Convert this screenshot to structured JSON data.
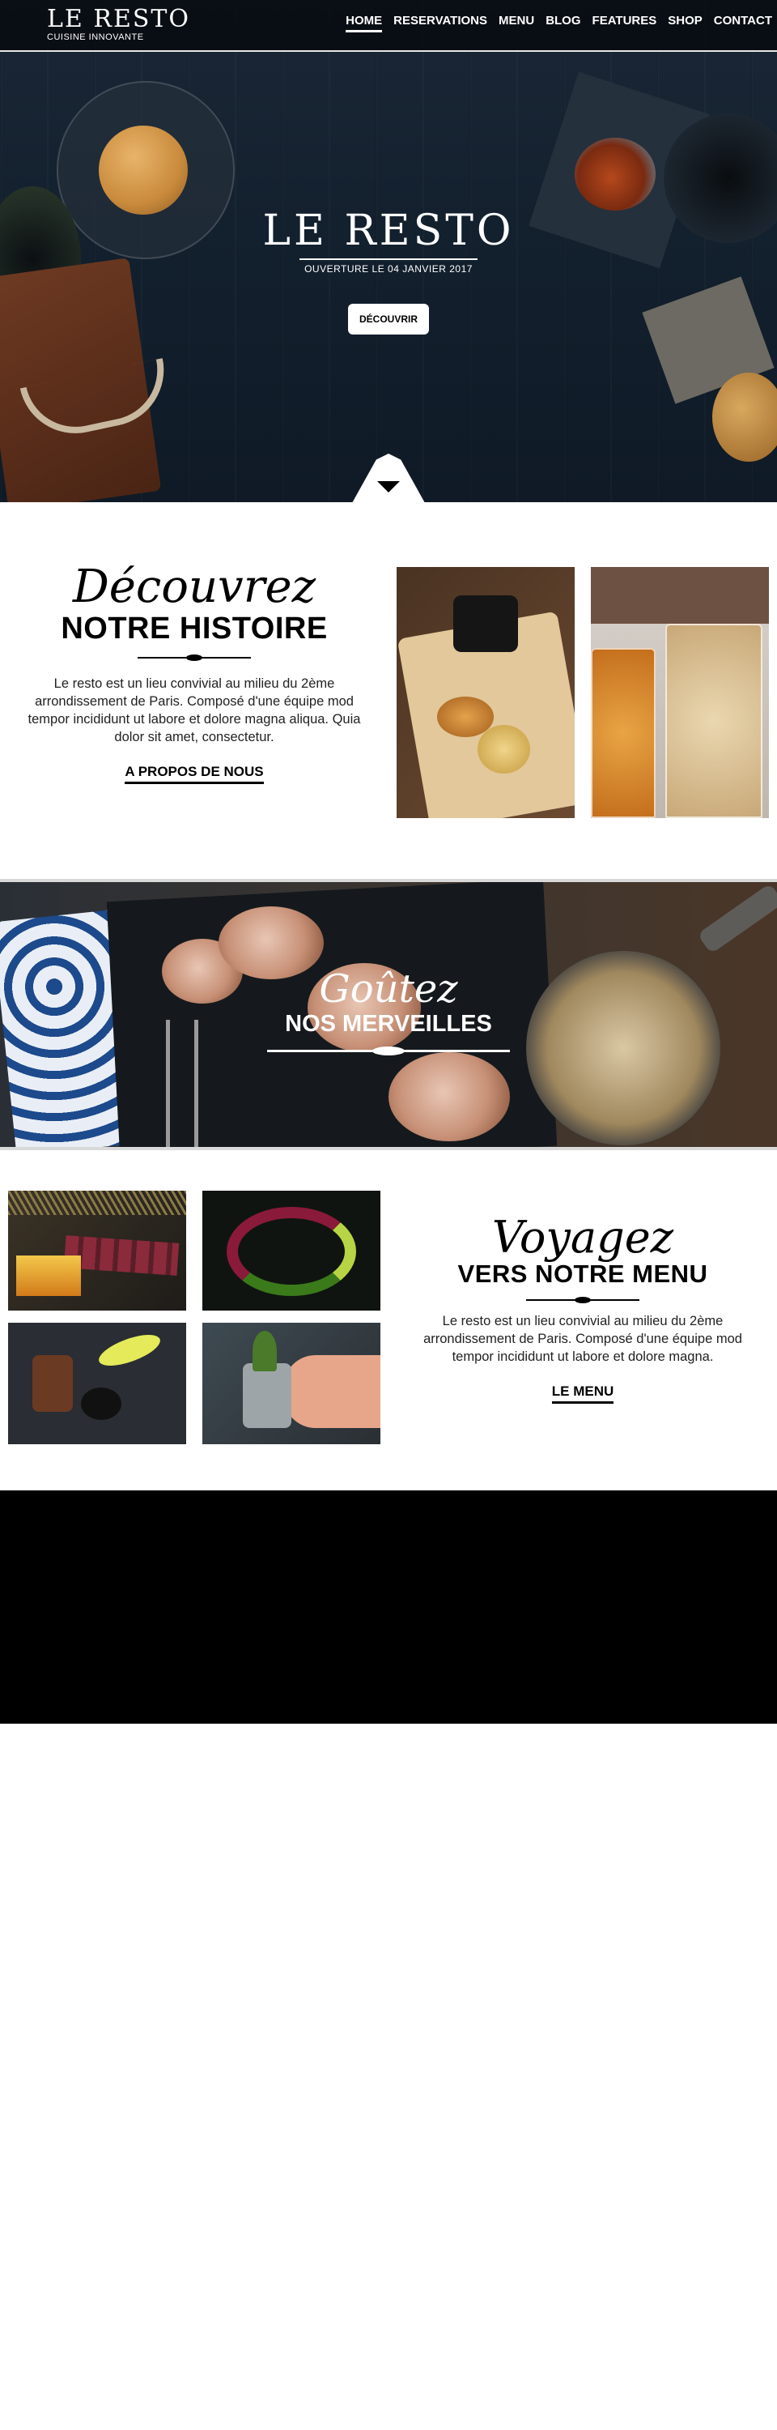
{
  "nav": {
    "brand": "LE RESTO",
    "tagline": "CUISINE INNOVANTE",
    "items": [
      {
        "label": "HOME",
        "active": true
      },
      {
        "label": "RESERVATIONS",
        "active": false
      },
      {
        "label": "MENU",
        "active": false
      },
      {
        "label": "BLOG",
        "active": false
      },
      {
        "label": "FEATURES",
        "active": false
      },
      {
        "label": "SHOP",
        "active": false
      },
      {
        "label": "CONTACT",
        "active": false
      }
    ]
  },
  "hero": {
    "title": "LE RESTO",
    "subtitle": "OUVERTURE LE 04 JANVIER 2017",
    "button": "DÉCOUVRIR"
  },
  "story": {
    "script": "Découvrez",
    "heading": "NOTRE HISTOIRE",
    "paragraph": "Le resto est un lieu convivial au milieu du 2ème arrondissement de Paris. Composé d'une équipe mod tempor incididunt ut labore et dolore magna aliqua. Quia dolor sit amet, consectetur.",
    "link": "A PROPOS DE NOUS"
  },
  "banner": {
    "script": "Goûtez",
    "heading": "NOS MERVEILLES"
  },
  "menu_section": {
    "script": "Voyagez",
    "heading": "VERS NOTRE MENU",
    "paragraph": "Le resto est un lieu convivial au milieu du 2ème arrondissement de Paris. Composé d'une équipe mod tempor incididunt ut labore et dolore magna.",
    "link": "LE MENU"
  },
  "colors": {
    "nav_background": "#0a0e12",
    "accent": "#ffffff",
    "black_block": "#000000"
  }
}
